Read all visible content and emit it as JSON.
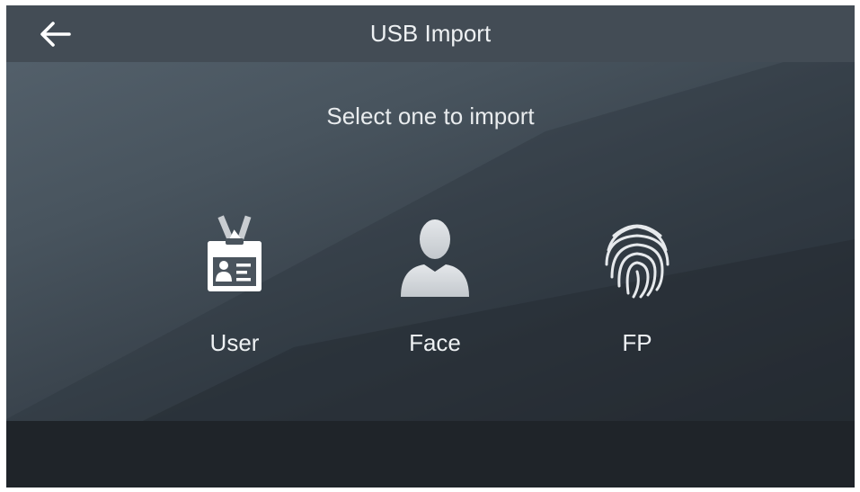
{
  "header": {
    "title": "USB Import",
    "back_icon": "arrow-left-icon"
  },
  "main": {
    "prompt": "Select one to import",
    "options": [
      {
        "label": "User",
        "icon": "id-card-icon"
      },
      {
        "label": "Face",
        "icon": "person-silhouette-icon"
      },
      {
        "label": "FP",
        "icon": "fingerprint-icon"
      }
    ]
  },
  "colors": {
    "header_bg": "#434c55",
    "text": "#eef1f3",
    "bottom_band": "#1f2429"
  }
}
